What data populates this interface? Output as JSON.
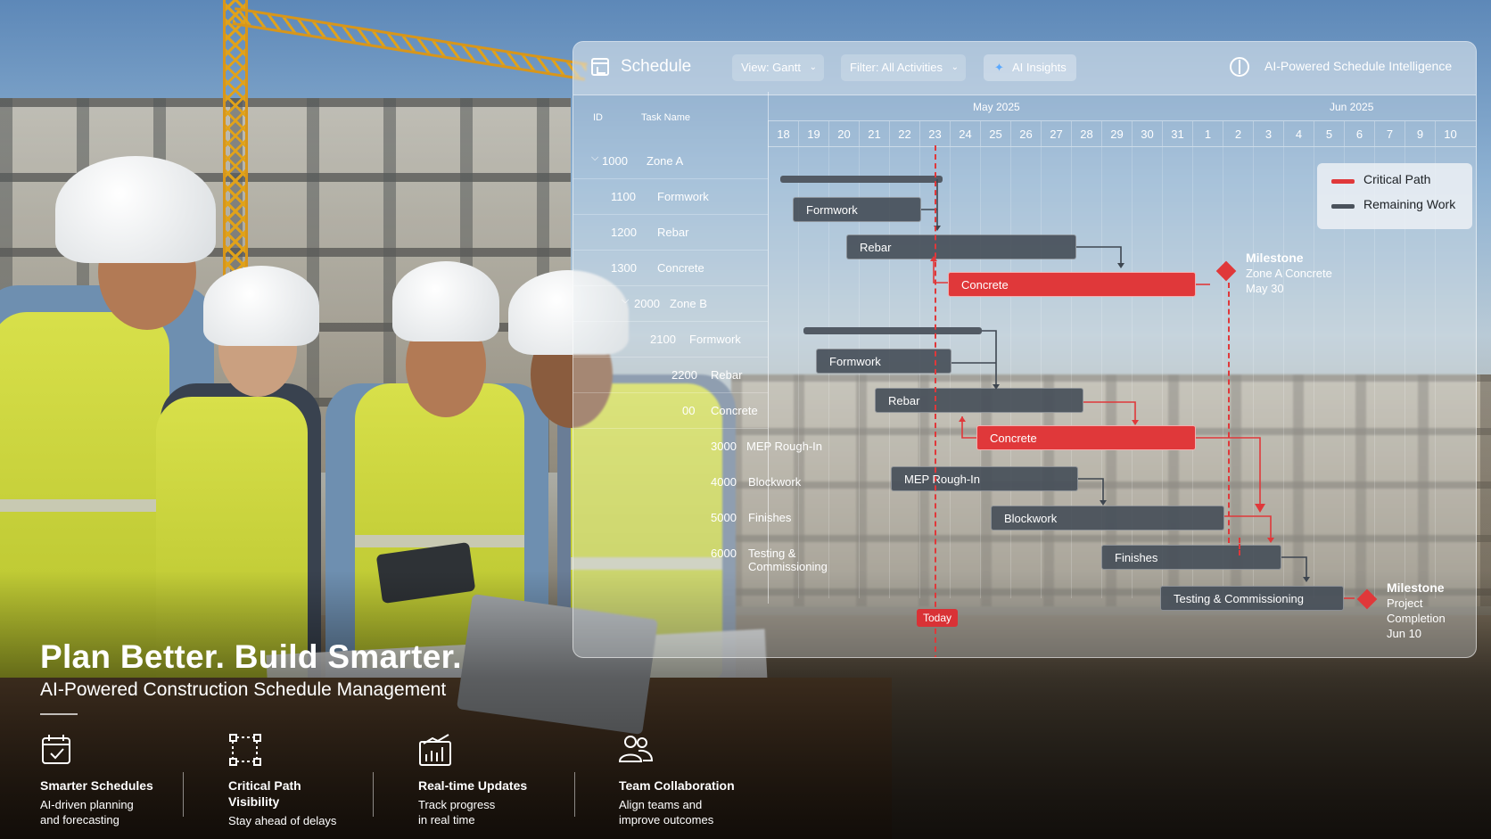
{
  "schedule": {
    "title": "Schedule",
    "view_label": "View: Gantt",
    "filter_label": "Filter: All Activities",
    "ai_insights_label": "AI Insights",
    "ai_title": "AI-Powered Schedule Intelligence",
    "col_id": "ID",
    "col_task": "Task Name",
    "month_may": "May 2025",
    "month_jun": "Jun 2025",
    "days": [
      "18",
      "19",
      "20",
      "21",
      "22",
      "23",
      "24",
      "25",
      "26",
      "27",
      "28",
      "29",
      "30",
      "31",
      "1",
      "2",
      "3",
      "4",
      "5",
      "6",
      "7",
      "9",
      "10"
    ],
    "rows": [
      {
        "id": "1000",
        "name": "Zone A"
      },
      {
        "id": "1100",
        "name": "Formwork"
      },
      {
        "id": "1200",
        "name": "Rebar"
      },
      {
        "id": "1300",
        "name": "Concrete"
      },
      {
        "id": "2000",
        "name": "Zone B"
      },
      {
        "id": "2100",
        "name": "Formwork"
      },
      {
        "id": "2200",
        "name": "Rebar"
      },
      {
        "id": "00",
        "name": "Concrete"
      },
      {
        "id": "3000",
        "name": "MEP Rough-In"
      },
      {
        "id": "4000",
        "name": "Blockwork"
      },
      {
        "id": "5000",
        "name": "Finishes"
      },
      {
        "id": "6000",
        "name": "Testing & Commissioning"
      }
    ],
    "bars": {
      "a_formwork": "Formwork",
      "a_rebar": "Rebar",
      "a_concrete": "Concrete",
      "b_formwork": "Formwork",
      "b_rebar": "Rebar",
      "b_concrete": "Concrete",
      "mep": "MEP Rough-In",
      "blockwork": "Blockwork",
      "finishes": "Finishes",
      "testing": "Testing & Commissioning"
    },
    "legend": {
      "critical": "Critical Path",
      "remaining": "Remaining Work"
    },
    "milestone1": {
      "title": "Milestone",
      "name": "Zone A Concrete",
      "date": "May 30"
    },
    "milestone2": {
      "title": "Milestone",
      "name": "Project Completion",
      "date": "Jun 10"
    },
    "today_label": "Today",
    "colors": {
      "critical": "#e0383a",
      "remaining": "#4a525c"
    }
  },
  "hero": {
    "headline": "Plan Better. Build Smarter.",
    "subline": "AI-Powered Construction Schedule Management"
  },
  "features": [
    {
      "icon": "calendar-check-icon",
      "title": "Smarter Schedules",
      "desc1": "AI-driven planning",
      "desc2": "and forecasting"
    },
    {
      "icon": "critical-path-icon",
      "title": "Critical Path",
      "title2": "Visibility",
      "desc1": "Stay ahead of delays",
      "desc2": ""
    },
    {
      "icon": "bar-chart-icon",
      "title": "Real-time Updates",
      "desc1": "Track progress",
      "desc2": "in real time"
    },
    {
      "icon": "team-icon",
      "title": "Team Collaboration",
      "desc1": "Align teams and",
      "desc2": "improve outcomes"
    }
  ]
}
